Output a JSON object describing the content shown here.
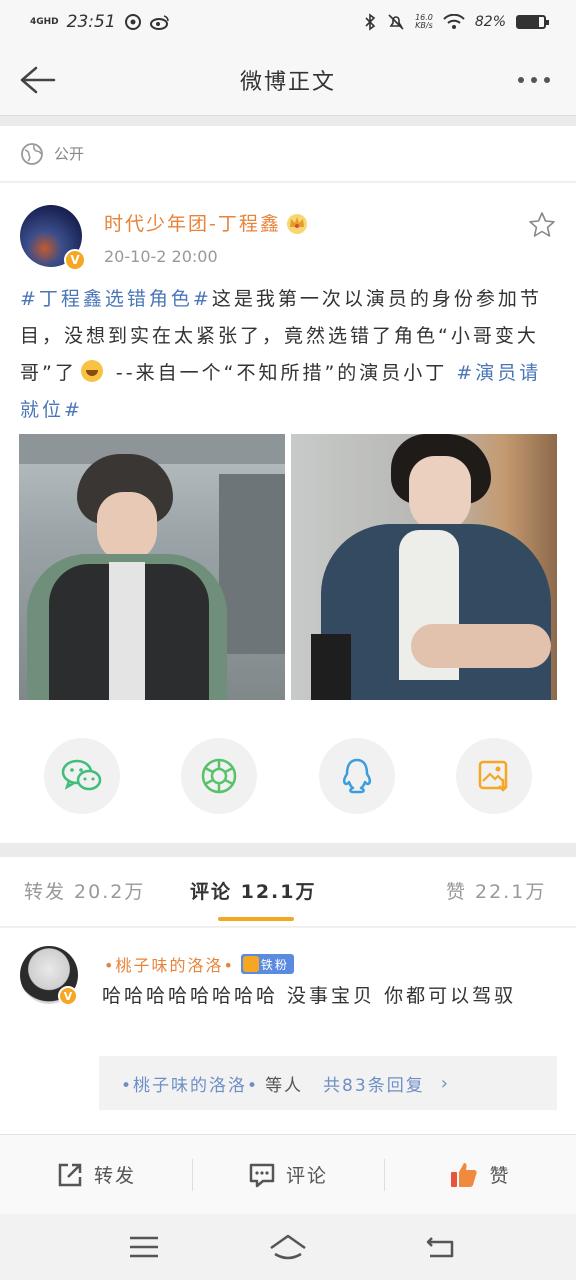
{
  "status_bar": {
    "network": "4GHD",
    "time": "23:51",
    "speed_value": "16.0",
    "speed_unit": "KB/s",
    "battery_text": "82%",
    "battery_level": 0.82
  },
  "nav": {
    "title": "微博正文"
  },
  "visibility": {
    "label": "公开"
  },
  "post": {
    "author": "时代少年团-丁程鑫",
    "date": "20-10-2 20:00",
    "tag1": "#丁程鑫选错角色#",
    "text1": "这是我第一次以演员的身份参加节目，没想到实在太紧张了，竟然选错了角色“小哥变大哥”了",
    "text2": " --来自一个“不知所措”的演员小丁 ",
    "tag2": "#演员请就位#"
  },
  "share": {
    "icons": [
      "wechat-icon",
      "moments-icon",
      "qq-icon",
      "save-image-icon"
    ],
    "colors": {
      "wechat": "#3fbd7a",
      "moments": "#58c26a",
      "qq": "#3a9de0",
      "save": "#f5a623"
    }
  },
  "tabs": {
    "repost": "转发 20.2万",
    "comment": "评论 12.1万",
    "like": "赞 22.1万"
  },
  "comment": {
    "name": "•桃子味的洛洛•",
    "badge": "铁粉",
    "text": "哈哈哈哈哈哈哈哈 没事宝贝 你都可以驾驭",
    "reply_user": "•桃子味的洛洛•",
    "reply_suffix": "等人",
    "reply_count": "共83条回复"
  },
  "actions": {
    "repost": "转发",
    "comment": "评论",
    "like": "赞"
  },
  "accent_color": "#f5a623"
}
